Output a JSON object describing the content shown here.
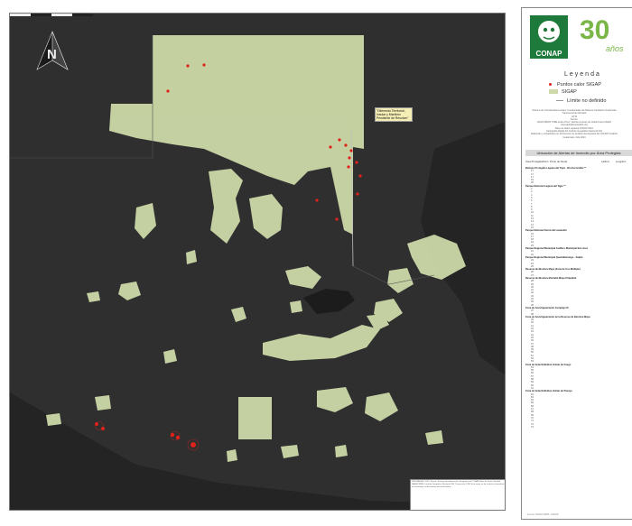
{
  "map": {
    "popup_text": "\"Diferendo Territorial, Insular y Marítimo Pendiente de Resolver\"",
    "north_arrow_label": "N",
    "frame_note": "DESCARGA Y USO. Fuente: Sistema de Información Geográfica de CONAP, Base de Datos Satelital NASA FIRMS, Instituto Geográfico Nacional IGN. Proyección GTM. Este mapa es de carácter informativo y no constituye un documento oficial de límites.",
    "colors": {
      "background": "#2d2d2e",
      "protected_area": "#cdd9a8",
      "hotspot": "#e0221b",
      "undefined_limit": "#bdbdbd",
      "lake": "#1c1c1d"
    }
  },
  "panel": {
    "logo_text": "CONAP",
    "anniversary_number": "30",
    "anniversary_word": "años",
    "legend_title": "Leyenda",
    "legend_items": [
      {
        "icon": "red-dot",
        "label": "Puntos calor SIGAP"
      },
      {
        "icon": "green-swatch",
        "label": "SIGAP"
      },
      {
        "icon": "gray-line",
        "label": "Límite no definido"
      }
    ],
    "credits": [
      "Sistema de Coordenadas Locales: Coordenadas del Sistema Geodésico Guatemala Transversal de Mercator",
      "GTM",
      "Fuente:",
      "NASA FIRMS \"FIRE Active Fires\"; Alertas a través de Global Forest Watch",
      "www.globalforestwatch.org",
      "Base de datos espacial CONAP 2024",
      "Cartografía Digital del Instituto Geográfico Nacional IGN",
      "Elaborado y actualizado por la Dirección de Análisis Geoespacial del CONAP (Análisis",
      "Guatemala, Julio 2024"
    ],
    "table_title": "Ubicación de Alertas de Incendio por Área Protegida",
    "table_columns": [
      "Área Protegida/Núm. Punto de Alerta",
      "Latitud",
      "Longitud"
    ],
    "table_groups": [
      {
        "name": "Biotopo Protegido Laguna del Tigre - Río Escondido **",
        "rows": [
          "17",
          "17",
          "17",
          "19",
          "20"
        ]
      },
      {
        "name": "Parque Nacional Laguna del Tigre **",
        "rows": [
          "2",
          "3",
          "4",
          "5",
          "6",
          "7",
          "8",
          "9",
          "10",
          "11",
          "12",
          "13",
          "14",
          "15"
        ]
      },
      {
        "name": "Parque Nacional Sierra del Lacandón",
        "rows": [
          "16",
          "17",
          "18",
          "19",
          "20"
        ]
      },
      {
        "name": "Parque Regional Municipal Astillero Municipal San José",
        "rows": [
          "21",
          "22"
        ]
      },
      {
        "name": "Parque Regional Municipal Quetzaltenango - Saqbé",
        "rows": [
          "23",
          "24",
          "25"
        ]
      },
      {
        "name": "Reserva de Biosfera Maya (Zona de Uso Múltiple)",
        "rows": [
          "26",
          "27"
        ]
      },
      {
        "name": "Reserva de Biosfera Montaña Maya Chiquibul",
        "rows": [
          "28",
          "29",
          "30",
          "31",
          "32",
          "33",
          "34",
          "35",
          "36"
        ]
      },
      {
        "name": "Zona de Amortiguamiento Complejo III",
        "rows": [
          "37",
          "38"
        ]
      },
      {
        "name": "Zona de Amortiguamiento de la Reserva de Biosfera Maya",
        "rows": [
          "39",
          "40",
          "41",
          "42",
          "43",
          "44",
          "45",
          "46",
          "47",
          "48",
          "49",
          "50",
          "51",
          "52",
          "53"
        ]
      },
      {
        "name": "Zona de Veda Definitiva Volcán de Fuego",
        "rows": [
          "54",
          "55",
          "56",
          "57",
          "58",
          "59",
          "60",
          "61"
        ]
      },
      {
        "name": "Zona de Veda Definitiva Volcán de Pacaya",
        "rows": [
          "62",
          "63",
          "64",
          "65",
          "66",
          "67",
          "68",
          "69",
          "70",
          "71",
          "72",
          "73"
        ]
      }
    ],
    "footer": "Fuente: NASA FIRMS, CONAP"
  }
}
